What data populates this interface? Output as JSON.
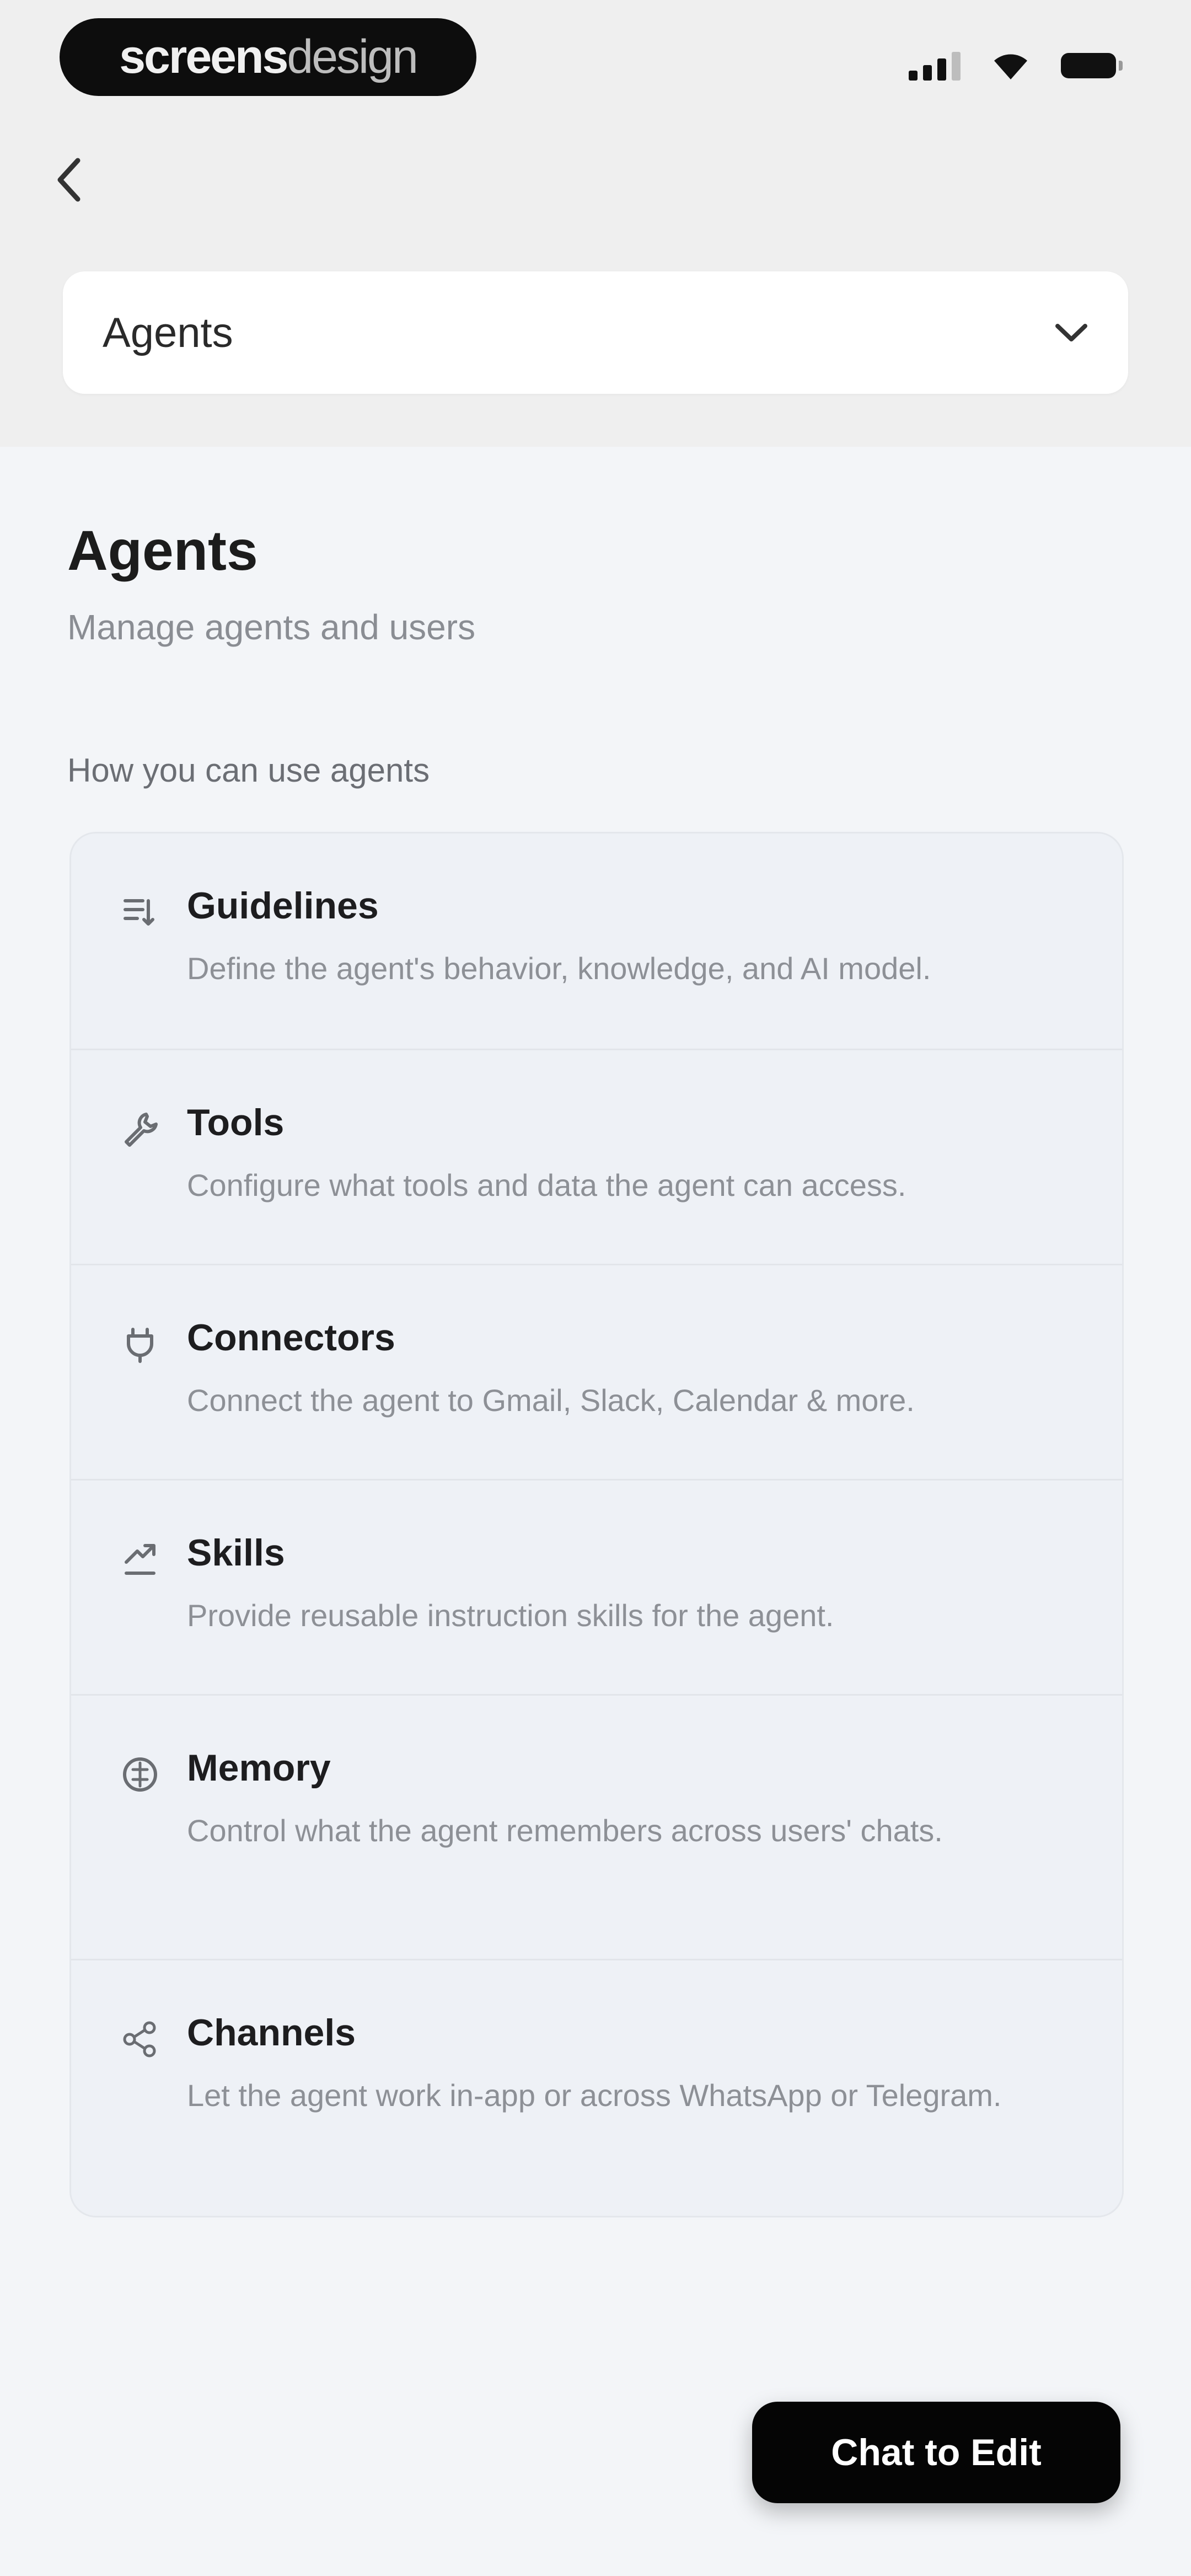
{
  "status_bar": {
    "brand_bold": "screens",
    "brand_light": "design"
  },
  "header": {
    "dropdown_value": "Agents"
  },
  "main": {
    "title": "Agents",
    "subtitle": "Manage agents and users",
    "section_label": "How you can use agents",
    "features": [
      {
        "title": "Guidelines",
        "description": "Define the agent's behavior, knowledge, and AI model.",
        "icon": "guidelines-icon"
      },
      {
        "title": "Tools",
        "description": "Configure what tools and data the agent can access.",
        "icon": "wrench-icon"
      },
      {
        "title": "Connectors",
        "description": "Connect the agent to Gmail, Slack, Calendar & more.",
        "icon": "plug-icon"
      },
      {
        "title": "Skills",
        "description": "Provide reusable instruction skills for the agent.",
        "icon": "skills-icon"
      },
      {
        "title": "Memory",
        "description": "Control what the agent remembers across users' chats.",
        "icon": "memory-icon"
      },
      {
        "title": "Channels",
        "description": "Let the agent work in-app or across WhatsApp or Telegram.",
        "icon": "share-icon"
      }
    ]
  },
  "footer": {
    "chat_button": "Chat to Edit"
  }
}
